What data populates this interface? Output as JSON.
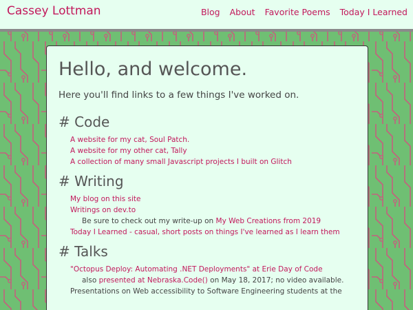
{
  "header": {
    "site_title": "Cassey Lottman",
    "nav": [
      "Blog",
      "About",
      "Favorite Poems",
      "Today I Learned"
    ]
  },
  "main": {
    "title": "Hello, and welcome.",
    "intro": "Here you'll find links to a few things I've worked on.",
    "sections": [
      {
        "heading": "# Code",
        "items": [
          "A website for my cat, Soul Patch.",
          "A website for my other cat, Tally",
          "A collection of many small Javascript projects I built on Glitch"
        ]
      },
      {
        "heading": "# Writing",
        "items": [
          "My blog on this site",
          "Writings on dev.to"
        ],
        "note": {
          "prefix": "Be sure to check out my write-up on ",
          "link": "My Web Creations from 2019"
        },
        "after_note": "Today I Learned - casual, short posts on things I've learned as I learn them"
      },
      {
        "heading": "# Talks",
        "items": [
          "\"Octopus Deploy: Automating .NET Deployments\" at Erie Day of Code"
        ],
        "note": {
          "prefix": "also ",
          "link": "presented at Nebraska.Code()",
          "suffix": " on May 18, 2017; no video available."
        },
        "after_note": "Presentations on Web accessibility to Software Engineering students at the"
      }
    ]
  },
  "colors": {
    "accent": "#c2185b",
    "background_green": "#6fbf73",
    "circuit_line": "#c4607e",
    "panel": "#e6fff0",
    "header_border": "#8a8a8a"
  }
}
